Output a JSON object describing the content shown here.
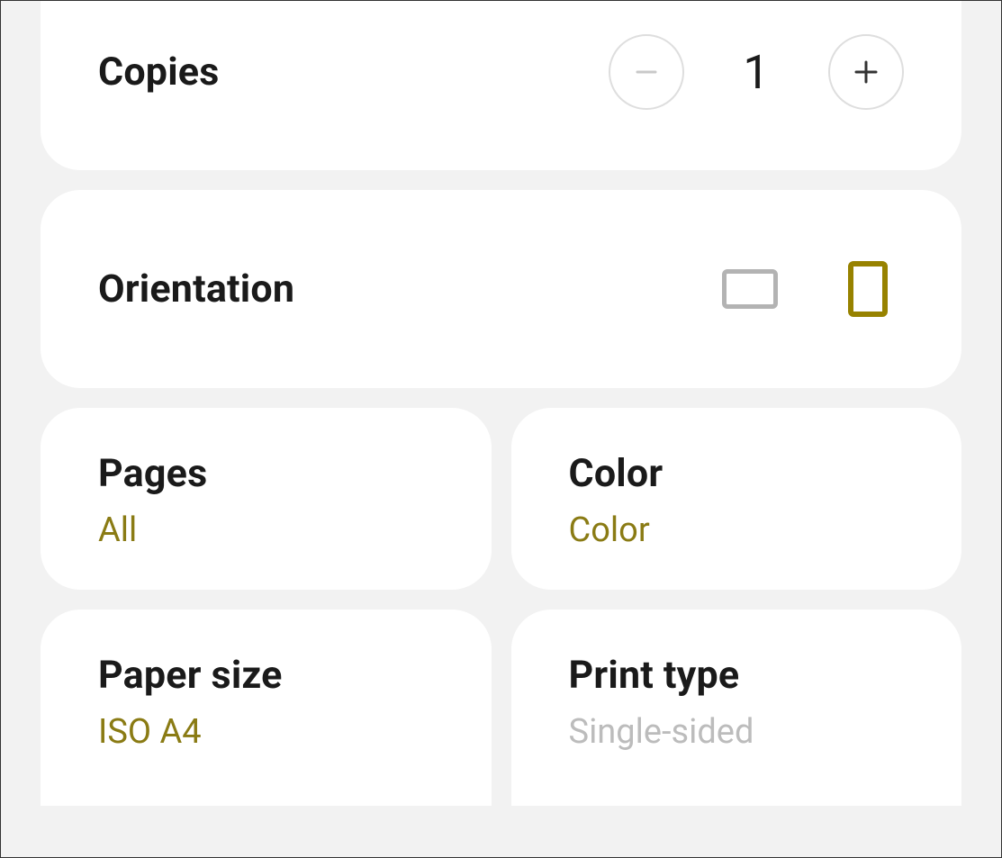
{
  "copies": {
    "label": "Copies",
    "value": "1"
  },
  "orientation": {
    "label": "Orientation",
    "selected": "portrait"
  },
  "pages": {
    "label": "Pages",
    "value": "All"
  },
  "color": {
    "label": "Color",
    "value": "Color"
  },
  "paperSize": {
    "label": "Paper size",
    "value": "ISO A4"
  },
  "printType": {
    "label": "Print type",
    "value": "Single-sided"
  }
}
